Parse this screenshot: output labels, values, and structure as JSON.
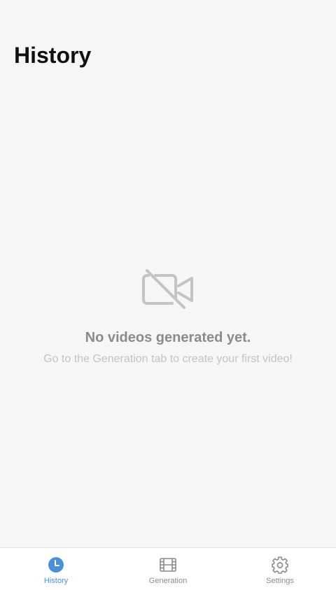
{
  "header": {
    "title": "History"
  },
  "empty_state": {
    "icon": "video-off-icon",
    "title": "No videos generated yet.",
    "subtitle": "Go to the Generation tab to create your first video!"
  },
  "tabbar": {
    "active_color": "#4a90d9",
    "inactive_color": "#8a8a8a",
    "tabs": [
      {
        "label": "History",
        "icon": "clock-icon",
        "active": true
      },
      {
        "label": "Generation",
        "icon": "film-icon",
        "active": false
      },
      {
        "label": "Settings",
        "icon": "gear-icon",
        "active": false
      }
    ]
  }
}
